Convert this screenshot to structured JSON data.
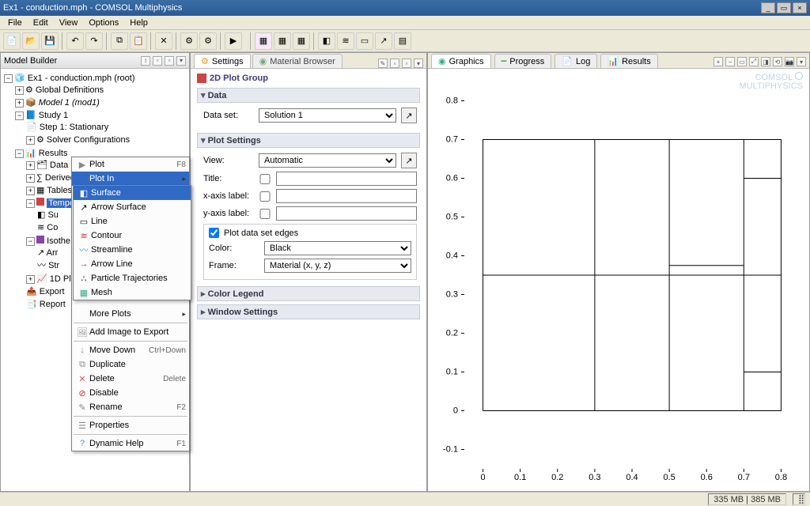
{
  "window": {
    "title": "Ex1 - conduction.mph - COMSOL Multiphysics",
    "min": "_",
    "max": "▭",
    "close": "×"
  },
  "menu": {
    "items": [
      "File",
      "Edit",
      "View",
      "Options",
      "Help"
    ]
  },
  "model_builder": {
    "title": "Model Builder",
    "root": "Ex1 - conduction.mph (root)",
    "nodes": {
      "global_def": "Global Definitions",
      "model1": "Model 1 (mod1)",
      "study1": "Study 1",
      "step1": "Step 1: Stationary",
      "solver_conf": "Solver Configurations",
      "results": "Results",
      "data_sets": "Data Sets",
      "derived_values": "Derived Values",
      "tables": "Tables",
      "temp_ht": "Temperature (ht)",
      "surf": "Su",
      "cont": "Co",
      "iso": "Isothe",
      "arr": "Arr",
      "str": "Str",
      "plot1d": "1D Plot",
      "export": "Export",
      "report": "Report"
    }
  },
  "context_menu": {
    "plot": "Plot",
    "plot_sc": "F8",
    "plot_in": "Plot In",
    "more_plots": "More Plots",
    "add_image": "Add Image to Export",
    "move_down": "Move Down",
    "move_down_sc": "Ctrl+Down",
    "duplicate": "Duplicate",
    "delete": "Delete",
    "delete_sc": "Delete",
    "disable": "Disable",
    "rename": "Rename",
    "rename_sc": "F2",
    "properties": "Properties",
    "dyn_help": "Dynamic Help",
    "dyn_help_sc": "F1"
  },
  "submenu": {
    "surface": "Surface",
    "arrow_surface": "Arrow Surface",
    "line": "Line",
    "contour": "Contour",
    "streamline": "Streamline",
    "arrow_line": "Arrow Line",
    "particle_traj": "Particle Trajectories",
    "mesh": "Mesh"
  },
  "settings": {
    "tab_settings": "Settings",
    "tab_material": "Material Browser",
    "title": "2D Plot Group",
    "sec_data": "Data",
    "data_set_label": "Data set:",
    "data_set_value": "Solution 1",
    "sec_plot": "Plot Settings",
    "view_label": "View:",
    "view_value": "Automatic",
    "title_label": "Title:",
    "xaxis_label": "x-axis label:",
    "yaxis_label": "y-axis label:",
    "plot_edges": "Plot data set edges",
    "color_label": "Color:",
    "color_value": "Black",
    "frame_label": "Frame:",
    "frame_value": "Material  (x, y, z)",
    "sec_legend": "Color Legend",
    "sec_window": "Window Settings"
  },
  "graphics": {
    "tab_graphics": "Graphics",
    "tab_progress": "Progress",
    "tab_log": "Log",
    "tab_results": "Results",
    "brand1": "COMSOL",
    "brand2": "MULTIPHYSICS"
  },
  "chart_data": {
    "type": "line",
    "title": "",
    "xlabel": "",
    "ylabel": "",
    "xlim": [
      -0.05,
      0.85
    ],
    "ylim": [
      -0.15,
      0.85
    ],
    "xticks": [
      0,
      0.1,
      0.2,
      0.3,
      0.4,
      0.5,
      0.6,
      0.7,
      0.8
    ],
    "yticks": [
      -0.1,
      0,
      0.1,
      0.2,
      0.3,
      0.4,
      0.5,
      0.6,
      0.7,
      0.8
    ],
    "geometry_edges": [
      {
        "x": [
          0,
          0.8,
          0.8,
          0,
          0
        ],
        "y": [
          0,
          0,
          0.7,
          0.7,
          0
        ]
      },
      {
        "x": [
          0.3,
          0.3
        ],
        "y": [
          0,
          0.7
        ]
      },
      {
        "x": [
          0.5,
          0.5
        ],
        "y": [
          0,
          0.7
        ]
      },
      {
        "x": [
          0.7,
          0.7
        ],
        "y": [
          0,
          0.7
        ]
      },
      {
        "x": [
          0,
          0.8
        ],
        "y": [
          0.35,
          0.35
        ]
      },
      {
        "x": [
          0.5,
          0.7
        ],
        "y": [
          0.375,
          0.375
        ]
      },
      {
        "x": [
          0.7,
          0.8
        ],
        "y": [
          0.1,
          0.1
        ]
      },
      {
        "x": [
          0.7,
          0.8
        ],
        "y": [
          0.6,
          0.6
        ]
      }
    ]
  },
  "status": {
    "mem": "335 MB | 385 MB"
  }
}
